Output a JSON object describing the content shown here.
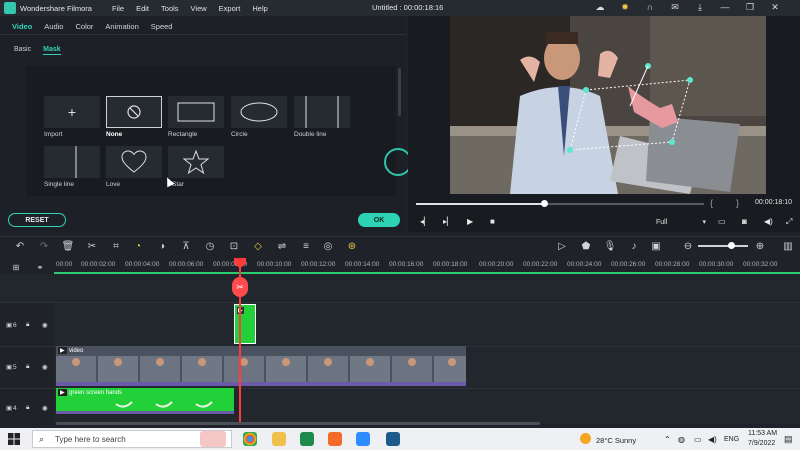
{
  "app": {
    "name": "Wondershare Filmora",
    "menu": [
      "File",
      "Edit",
      "Tools",
      "View",
      "Export",
      "Help"
    ],
    "doc_title": "Untitled : 00:00:18:16"
  },
  "left_panel": {
    "tabs": [
      "Video",
      "Audio",
      "Color",
      "Animation",
      "Speed"
    ],
    "active_tab": "Video",
    "subtabs": [
      "Basic",
      "Mask"
    ],
    "active_subtab": "Mask",
    "masks": [
      {
        "label": "Import",
        "icon": "plus-icon"
      },
      {
        "label": "None",
        "icon": "none-icon",
        "selected": true
      },
      {
        "label": "Rectangle",
        "icon": "rectangle-icon"
      },
      {
        "label": "Circle",
        "icon": "ellipse-icon"
      },
      {
        "label": "Double line",
        "icon": "double-line-icon"
      },
      {
        "label": "Single line",
        "icon": "single-line-icon"
      },
      {
        "label": "Love",
        "icon": "heart-icon"
      },
      {
        "label": "Star",
        "icon": "star-icon"
      }
    ],
    "reset_label": "RESET",
    "ok_label": "OK"
  },
  "preview": {
    "timecode": "00:00:18:10",
    "brace_open": "{",
    "brace_close": "}",
    "quality": "Full",
    "progress": 0.44
  },
  "timeline": {
    "ruler": [
      "00:00",
      "00:00:02:00",
      "00:00:04:00",
      "00:00:06:00",
      "00:00:08:00",
      "00:00:10:00",
      "00:00:12:00",
      "00:00:14:00",
      "00:00:16:00",
      "00:00:18:00",
      "00:00:20:00",
      "00:00:22:00",
      "00:00:24:00",
      "00:00:26:00",
      "00:00:28:00",
      "00:00:30:00",
      "00:00:32:00"
    ],
    "tracks": [
      {
        "number": "6"
      },
      {
        "number": "5"
      },
      {
        "number": "4"
      }
    ],
    "clips": {
      "video_title": "video",
      "green_title": "green screen hands"
    }
  },
  "taskbar": {
    "search_placeholder": "Type here to search",
    "weather": "28°C  Sunny",
    "language": "ENG",
    "time": "11:53 AM",
    "date": "7/9/2022"
  },
  "colors": {
    "accent": "#2ed3b5",
    "playhead": "#ff3b3b",
    "green_clip": "#22d13a"
  }
}
